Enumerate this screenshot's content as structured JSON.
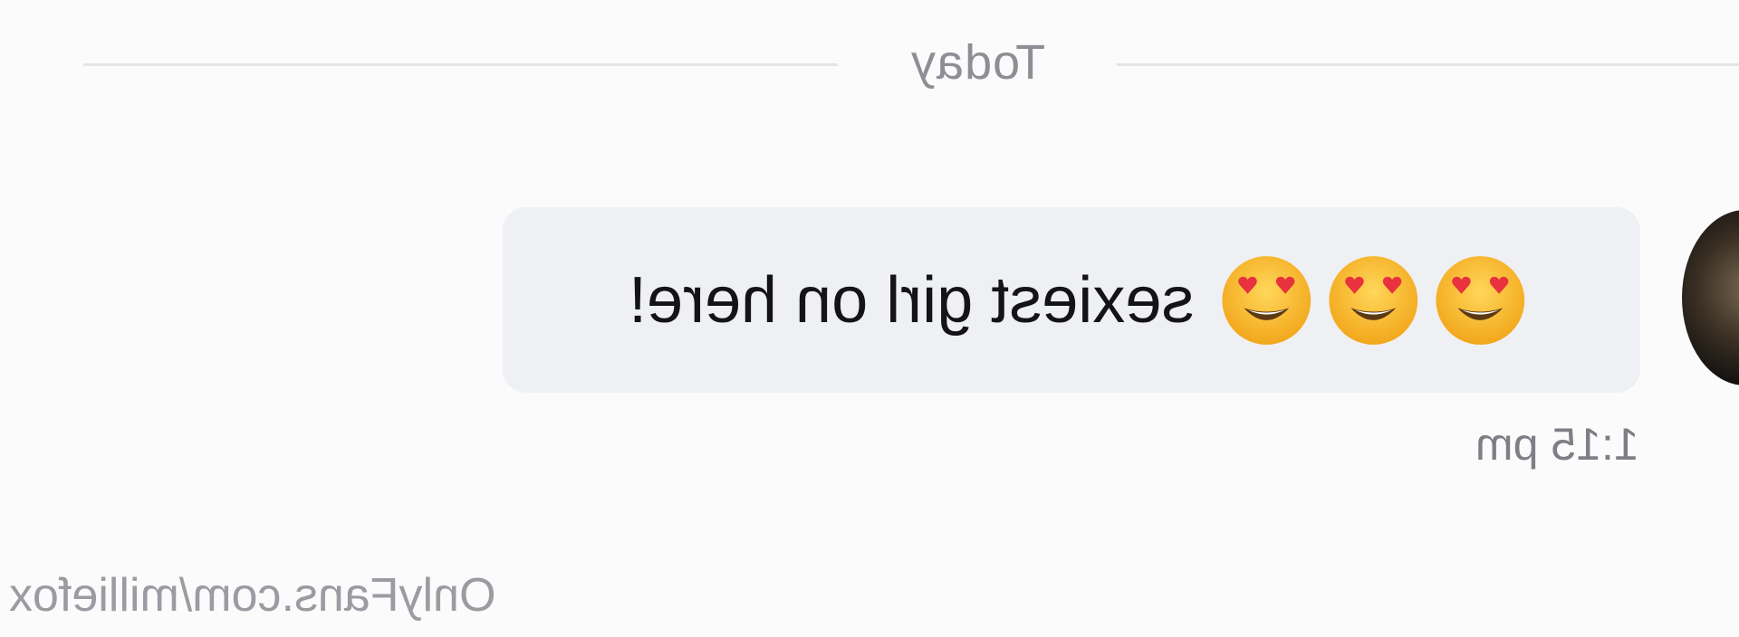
{
  "divider": {
    "label": "Today"
  },
  "message": {
    "text": "sexiest girl on here!",
    "emojis": [
      "heart-eyes-emoji",
      "heart-eyes-emoji",
      "heart-eyes-emoji"
    ],
    "timestamp": "1:15 pm",
    "bubble_color": "#eff0f3"
  },
  "watermark": {
    "text": "OnlyFans.com/milliefox"
  },
  "display": {
    "mirrored": true
  }
}
